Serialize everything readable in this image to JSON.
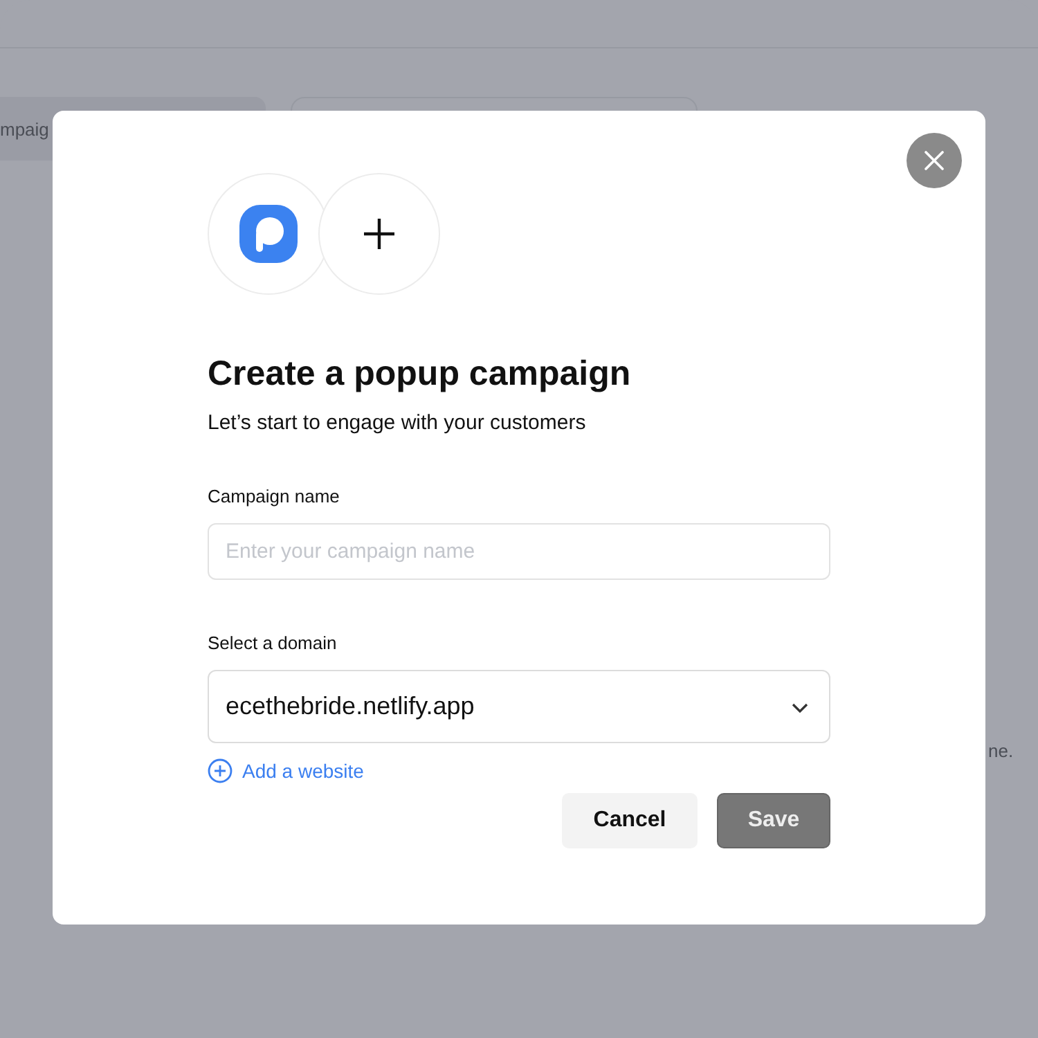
{
  "background": {
    "tab_label": "mpaig",
    "note": "ne."
  },
  "dialog": {
    "title": "Create a popup campaign",
    "subtitle": "Let’s start to engage with your customers",
    "fields": [
      {
        "kind": "text",
        "label": "Campaign name",
        "placeholder": "Enter your campaign name"
      },
      {
        "kind": "select",
        "label": "Select a domain",
        "value": "ecethebride.netlify.app"
      }
    ],
    "add_link": "Add a website",
    "buttons": [
      {
        "kind": "secondary",
        "label": "Cancel"
      },
      {
        "kind": "primary",
        "label": "Save"
      }
    ]
  }
}
